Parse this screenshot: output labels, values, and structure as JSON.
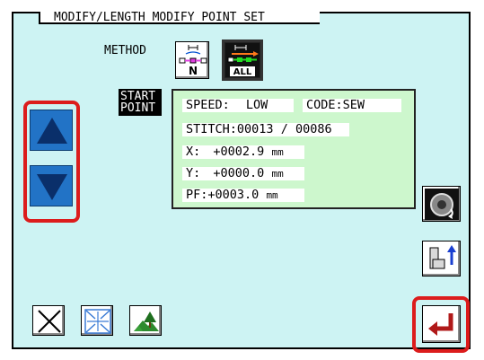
{
  "screen": {
    "title": "MODIFY/LENGTH MODIFY  POINT SET",
    "method_label": "METHOD",
    "start_point_label": "START POINT"
  },
  "method_buttons": [
    {
      "name": "method-n",
      "glyph": "N",
      "selected": false
    },
    {
      "name": "method-all",
      "glyph": "ALL",
      "selected": true
    }
  ],
  "info": {
    "speed_label": "SPEED:",
    "speed_value": "LOW",
    "code_label": "CODE:",
    "code_value": "SEW",
    "stitch_label": "STITCH:",
    "stitch_current": "00013",
    "stitch_sep": "/",
    "stitch_total": "00086",
    "x_label": "X:",
    "x_value": "+0002.9",
    "x_unit": "mm",
    "y_label": "Y:",
    "y_value": "+0000.0",
    "y_unit": "mm",
    "pf_label": "PF:",
    "pf_value": "+0003.0",
    "pf_unit": "mm"
  },
  "colors": {
    "panel": "#cdf3f3",
    "highlight": "#dc1c1c",
    "arrow_blue": "#2273c6",
    "info_green": "#cdf7cd",
    "enter_red": "#b01919"
  }
}
